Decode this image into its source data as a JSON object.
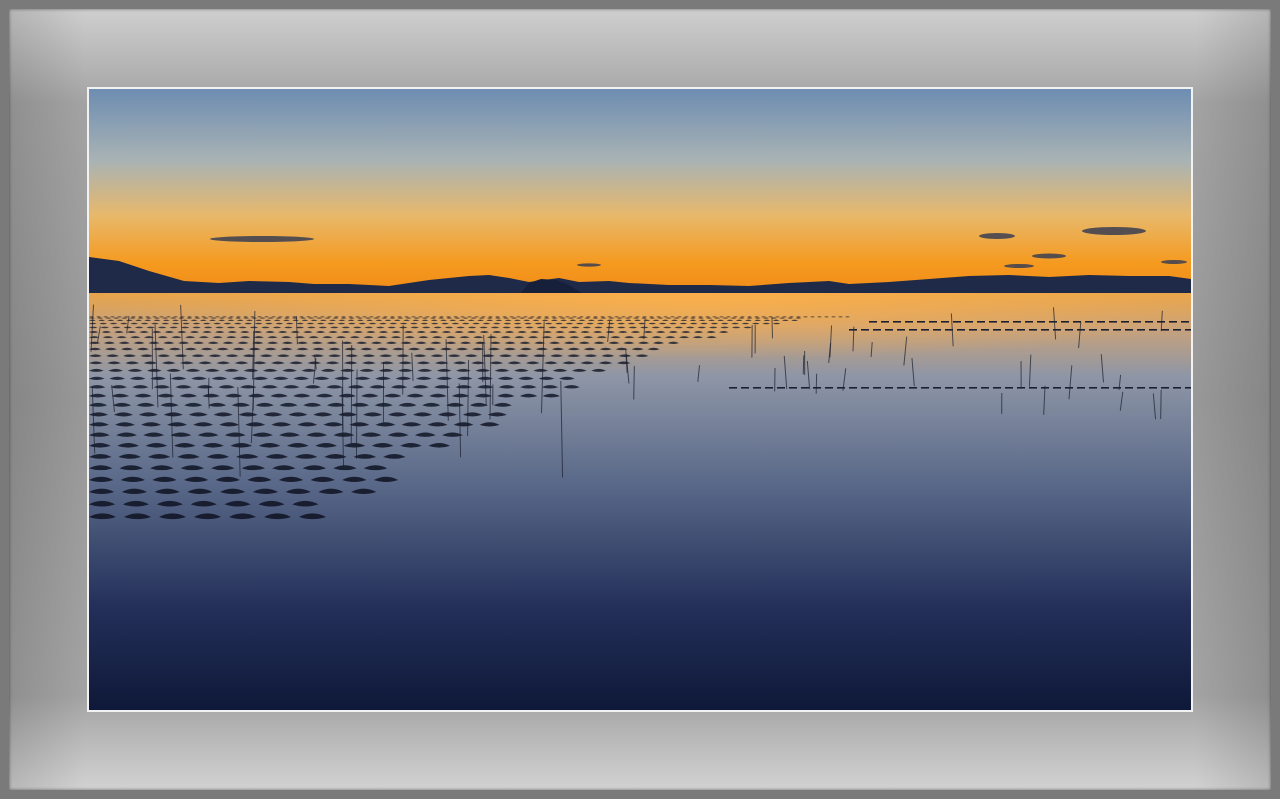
{
  "scene": {
    "subject": "",
    "colors": {
      "sky_top": "#6f8fb3",
      "sky_mid": "#c9b79a",
      "horizon": "#f49a1c",
      "water_glow": "#e9a74a",
      "water_mid": "#4d5e80",
      "water_deep": "#0f1a38",
      "silhouette": "#1e2a46",
      "frame_mat": "#9c9c9c",
      "frame_border": "#f2f2f2"
    }
  }
}
